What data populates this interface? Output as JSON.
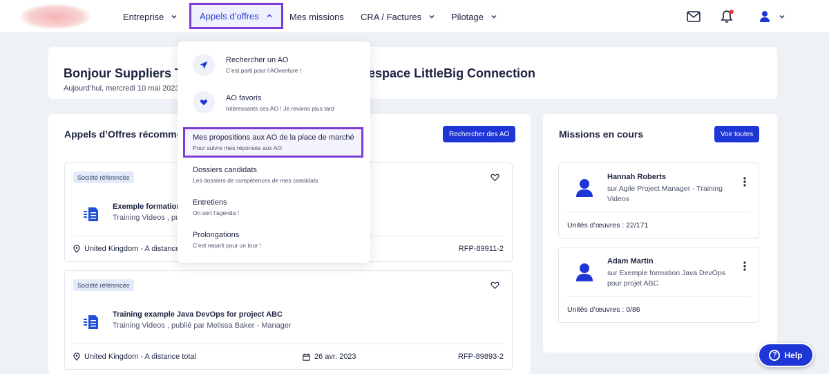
{
  "nav": {
    "items": [
      {
        "label": "Entreprise"
      },
      {
        "label": "Appels d’offres"
      },
      {
        "label": "Mes missions"
      },
      {
        "label": "CRA / Factures"
      },
      {
        "label": "Pilotage"
      }
    ],
    "icons": [
      "mail-icon",
      "bell-icon",
      "user-icon"
    ]
  },
  "welcome": {
    "title_start": "Bonjour Suppliers T",
    "title_end": "re espace LittleBig Connection",
    "date": "Aujourd’hui, mercredi 10 mai 2023"
  },
  "ao_section": {
    "title": "Appels d’Offres récomme",
    "search_button": "Rechercher des AO",
    "cards": [
      {
        "badge": "Société référencée",
        "title": "Exemple formation",
        "subtitle": "Training Videos , pu",
        "location": "United Kingdom - A distance",
        "ref": "RFP-89911-2"
      },
      {
        "badge": "Société référencée",
        "title": "Training example Java DevOps for project ABC",
        "subtitle": "Training Videos , publié par Melissa Baker - Manager",
        "location": "United Kingdom - A distance total",
        "date": "26 avr. 2023",
        "ref": "RFP-89893-2"
      }
    ]
  },
  "missions": {
    "title": "Missions en cours",
    "see_all": "Voir toutes",
    "cards": [
      {
        "name": "Hannah Roberts",
        "subtitle": "sur Agile Project Manager - Training Videos",
        "units": "Unités d’œuvres : 22/171"
      },
      {
        "name": "Adam Martin",
        "subtitle": "sur Exemple formation Java DevOps pour projet ABC",
        "units": "Unités d’œuvres : 0/86"
      }
    ]
  },
  "dropdown": {
    "items": [
      {
        "label": "Rechercher un AO",
        "sub": "C’est parti pour l’AOventure !",
        "icon": "send-icon"
      },
      {
        "label": "AO favoris",
        "sub": "Intéressants ces AO ! Je reviens plus tard",
        "icon": "heart-icon"
      },
      {
        "label": "Mes propositions aux AO de la place de marché",
        "sub": "Pour suivre mes réponses aux AO"
      },
      {
        "label": "Dossiers candidats",
        "sub": "Les dossiers de compétences de mes candidats"
      },
      {
        "label": "Entretiens",
        "sub": "On sort l’agenda !"
      },
      {
        "label": "Prolongations",
        "sub": "C’est reparti pour un tour !"
      }
    ]
  },
  "help": {
    "label": "Help"
  },
  "colors": {
    "accent": "#1f36d6",
    "highlight": "#7a3bd9",
    "background": "#eef1f6"
  }
}
